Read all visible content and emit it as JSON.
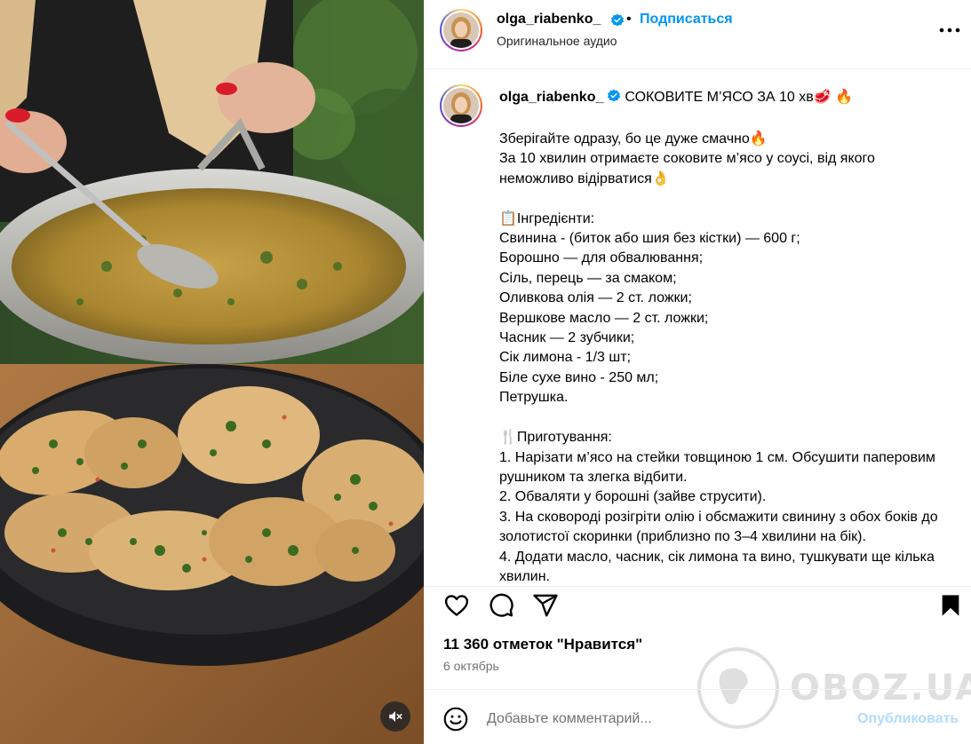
{
  "post": {
    "username": "olga_riabenko_",
    "follow_label": "Подписаться",
    "dot": "•",
    "audio": "Оригинальное аудио",
    "caption_title": "СОКОВИТЕ М’ЯСО ЗА 10 хв🥩 🔥",
    "caption_body": "Зберігайте одразу, бо це дуже смачно🔥\nЗа 10 хвилин отримаєте соковите м’ясо у соусі, від якого неможливо відірватися👌\n\n📋Інгредієнти:\nСвинина - (биток або шия без кістки) — 600 г;\nБорошно — для обвалювання;\nСіль, перець — за смаком;\nОливкова олія — 2 ст. ложки;\nВершкове масло — 2 ст. ложки;\nЧасник — 2 зубчики;\nСік лимона - 1/3 шт;\nБіле сухе вино - 250 мл;\nПетрушка.\n\n🍴Приготування:\n1. Нарізати м’ясо на стейки товщиною 1 см. Обсушити паперовим рушником та злегка відбити.\n2. Обваляти у борошні (зайве струсити).\n3. На сковороді розігріти олію і обсмажити свинину з обох боків до золотистої скоринки (приблизно по 3–4 хвилини на бік).\n4. Додати масло, часник, сік лимона та вино, тушкувати ще кілька хвилин.",
    "likes": "11 360 отметок \"Нравится\"",
    "date": "6 октябрь"
  },
  "comment": {
    "placeholder": "Добавьте комментарий...",
    "publish_label": "Опубликовать"
  },
  "watermark": {
    "text": "OBOZ.UA"
  },
  "icons": {
    "verified": "verified-badge-icon",
    "more": "more-options-icon",
    "like": "heart-icon",
    "comment": "comment-icon",
    "share": "share-icon",
    "save": "bookmark-icon",
    "emoji": "emoji-icon",
    "mute": "speaker-muted-icon"
  },
  "colors": {
    "accent": "#0095f6",
    "publish_disabled": "#b3dbff",
    "muted_text": "#737373",
    "divider": "#efefef"
  }
}
